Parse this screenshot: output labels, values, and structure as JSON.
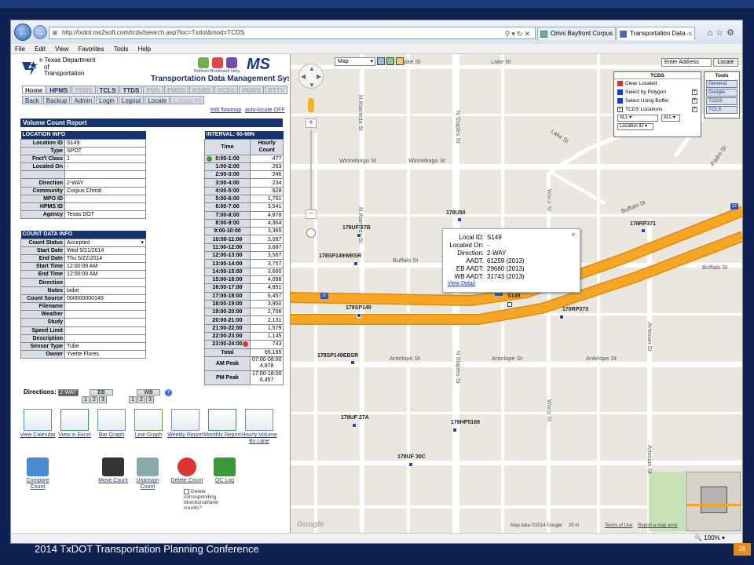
{
  "browser": {
    "url": "http://txdot.ms2soft.com/tcds/tsearch.asp?loc=Txdot&mod=TCDS",
    "tabs": [
      {
        "label": "Omni Bayfront Corpus ..."
      },
      {
        "label": "Transportation Data ..."
      }
    ],
    "menu": [
      "File",
      "Edit",
      "View",
      "Favorites",
      "Tools",
      "Help"
    ],
    "zoom": "100%"
  },
  "header": {
    "org": "Texas Department of Transportation",
    "org_line1": "Texas Department",
    "org_line2": "of",
    "org_line3": "Transportation",
    "system": "Transportation Data Management System",
    "icons": [
      "Refresh",
      "Bookmark",
      "Help"
    ],
    "brand": "MS"
  },
  "modules": [
    {
      "label": "Home",
      "dim": false,
      "on": true
    },
    {
      "label": "HPMS",
      "dim": false
    },
    {
      "label": "TSMS",
      "dim": true
    },
    {
      "label": "TCLS",
      "dim": false
    },
    {
      "label": "TTDS",
      "dim": false
    },
    {
      "label": "PMS",
      "dim": true
    },
    {
      "label": "PMDS",
      "dim": true
    },
    {
      "label": "RSMS",
      "dim": true
    },
    {
      "label": "PCDS",
      "dim": true
    },
    {
      "label": "PMMS",
      "dim": true
    },
    {
      "label": "RTTV",
      "dim": true
    }
  ],
  "actions": [
    {
      "label": "Back",
      "dim": false
    },
    {
      "label": "Backup",
      "dim": false
    },
    {
      "label": "Admin",
      "dim": false
    },
    {
      "label": "Login",
      "dim": false
    },
    {
      "label": "Logout",
      "dim": false
    },
    {
      "label": "Locate",
      "dim": false
    },
    {
      "label": "Locate All",
      "dim": true
    }
  ],
  "links": {
    "flowmap": "edit flowmap",
    "autolocate": "auto-locate OFF"
  },
  "report_title": "Volume Count Report",
  "location_info": {
    "title": "LOCATION INFO",
    "rows": [
      [
        "Location ID",
        "S149"
      ],
      [
        "Type",
        "SPOT"
      ],
      [
        "Fnct'l Class",
        "1"
      ],
      [
        "Located On",
        "-"
      ],
      [
        "",
        ""
      ],
      [
        "Direction",
        "2-WAY"
      ],
      [
        "Community",
        "Corpus Christi"
      ],
      [
        "MPO ID",
        ""
      ],
      [
        "HPMS ID",
        ""
      ],
      [
        "Agency",
        "Texas DOT"
      ]
    ]
  },
  "count_info": {
    "title": "COUNT DATA INFO",
    "rows": [
      [
        "Count Status",
        "Accepted"
      ],
      [
        "Start Date",
        "Wed 5/21/2014"
      ],
      [
        "End Date",
        "Thu 5/22/2014"
      ],
      [
        "Start Time",
        "12:00:00 AM"
      ],
      [
        "End Time",
        "12:00:00 AM"
      ],
      [
        "Direction",
        ""
      ],
      [
        "Notes",
        "txdot"
      ],
      [
        "Count Source",
        "000000000149"
      ],
      [
        "Filename",
        ""
      ],
      [
        "Weather",
        ""
      ],
      [
        "Study",
        ""
      ],
      [
        "Speed Limit",
        ""
      ],
      [
        "Description",
        ""
      ],
      [
        "Sensor Type",
        "Tube"
      ],
      [
        "Owner",
        "Yvette Flores"
      ]
    ]
  },
  "volume": {
    "title": "INTERVAL: 60-MIN",
    "col_time": "Time",
    "col_count": "Hourly Count",
    "rows": [
      [
        "0:00-1:00",
        "477"
      ],
      [
        "1:00-2:00",
        "263"
      ],
      [
        "2:00-3:00",
        "246"
      ],
      [
        "3:00-4:00",
        "234"
      ],
      [
        "4:00-5:00",
        "628"
      ],
      [
        "5:00-6:00",
        "1,761"
      ],
      [
        "6:00-7:00",
        "3,541"
      ],
      [
        "7:00-8:00",
        "4,878"
      ],
      [
        "8:00-9:00",
        "4,364"
      ],
      [
        "9:00-10:00",
        "3,365"
      ],
      [
        "10:00-11:00",
        "3,097"
      ],
      [
        "11:00-12:00",
        "3,687"
      ],
      [
        "12:00-13:00",
        "3,567"
      ],
      [
        "13:00-14:00",
        "3,757"
      ],
      [
        "14:00-15:00",
        "3,600"
      ],
      [
        "15:00-16:00",
        "4,098"
      ],
      [
        "16:00-17:00",
        "4,891"
      ],
      [
        "17:00-18:00",
        "6,457"
      ],
      [
        "18:00-19:00",
        "3,950"
      ],
      [
        "19:00-20:00",
        "2,706"
      ],
      [
        "20:00-21:00",
        "2,131"
      ],
      [
        "21:00-22:00",
        "1,579"
      ],
      [
        "22:00-23:00",
        "1,145"
      ],
      [
        "23:00-24:00",
        "743"
      ]
    ],
    "total_label": "Total",
    "total": "65,165",
    "am_label": "AM Peak",
    "am_time": "07:00-08:00",
    "am_val": "4,878",
    "pm_label": "PM Peak",
    "pm_time": "17:00-18:00",
    "pm_val": "6,457"
  },
  "directions": {
    "label": "Directions:",
    "twoway": "2-WAY",
    "eb": "EB",
    "wb": "WB",
    "nums": [
      "1",
      "2",
      "3"
    ]
  },
  "tools_row1": [
    "View Calendar",
    "View in Excel",
    "Bar Graph",
    "Line Graph",
    "Weekly Report",
    "Monthly Report",
    "Hourly Volume By Lane"
  ],
  "tools_row2": [
    "Compare Count",
    "Move Count",
    "Unassign Count",
    "Delete Count",
    "QC Log"
  ],
  "delete_note": "Delete corresponding directional/lane counts?",
  "map": {
    "type": "Map",
    "address_placeholder": "Enter Address",
    "locate": "Locate",
    "streets_h": [
      "Lake St",
      "Lake St",
      "Winnebago St",
      "Winnebago St",
      "Buffalo St",
      "Buffalo St",
      "Buffalo St",
      "Antelope St",
      "Antelope St",
      "Antelope St",
      "Lake St"
    ],
    "streets_v": [
      "N Alameda St",
      "N Staples St",
      "N Staples St",
      "Waco St",
      "N Alameda St",
      "Waco St",
      "Artesian St",
      "Padre St",
      "Artesian St"
    ],
    "markers": [
      "178UF 27B",
      "178U50",
      "178SP149WBSR",
      "178RP371",
      "178SP149",
      "178RP373",
      "178SP149EBSR",
      "178UF 27A",
      "178HP5169",
      "178UF 30C",
      "S149"
    ],
    "popup": {
      "rows": [
        [
          "Local ID:",
          "S149"
        ],
        [
          "Located On:",
          "-"
        ],
        [
          "Direction:",
          "2-WAY"
        ],
        [
          "AADT:",
          "61259 (2013)"
        ],
        [
          "EB AADT:",
          "29680 (2013)"
        ],
        [
          "WB AADT:",
          "31743 (2013)"
        ]
      ],
      "link": "View Detail"
    },
    "tcds": {
      "title": "TCDS",
      "items": [
        "Clear Located",
        "Select by Polygon",
        "Select Using Buffer",
        "TCDS Locations"
      ],
      "sel1": "ALL",
      "sel2": "ALL",
      "sel3": "Location ID"
    },
    "tools": {
      "title": "Tools",
      "items": [
        "General",
        "Google",
        "TCDS",
        "TCLS"
      ]
    },
    "shields": [
      "37",
      "37",
      "37",
      "37"
    ],
    "footer": "Map data ©2014 Google",
    "scale": "20 m",
    "terms": "Terms of Use",
    "report": "Report a map error",
    "google": "Google"
  },
  "slide": {
    "footer": "2014 TxDOT Transportation Planning Conference",
    "page": "26"
  },
  "colors": {
    "navy": "#15336f",
    "highway": "#f6a623",
    "marker": "#1a47c8",
    "slide_bg": "#0e2150"
  }
}
